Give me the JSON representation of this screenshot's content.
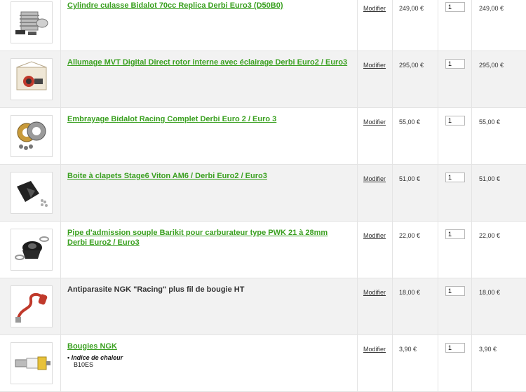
{
  "cart": {
    "items": [
      {
        "name": "Cylindre culasse Bidalot 70cc Replica Derbi Euro3 (D50B0)",
        "link": true,
        "icon": "cylinder-kit-icon",
        "modify_label": "Modifier",
        "unit_price": "249,00 €",
        "quantity": "1",
        "total": "249,00 €"
      },
      {
        "name": "Allumage MVT Digital Direct rotor interne avec éclairage Derbi Euro2 / Euro3",
        "link": true,
        "icon": "ignition-kit-icon",
        "modify_label": "Modifier",
        "unit_price": "295,00 €",
        "quantity": "1",
        "total": "295,00 €"
      },
      {
        "name": "Embrayage Bidalot Racing Complet Derbi Euro 2 / Euro 3",
        "link": true,
        "icon": "clutch-discs-icon",
        "modify_label": "Modifier",
        "unit_price": "55,00 €",
        "quantity": "1",
        "total": "55,00 €"
      },
      {
        "name": "Boite à clapets Stage6 Viton AM6 / Derbi Euro2 / Euro3",
        "link": true,
        "icon": "reed-valve-icon",
        "modify_label": "Modifier",
        "unit_price": "51,00 €",
        "quantity": "1",
        "total": "51,00 €"
      },
      {
        "name": "Pipe d'admission souple Barikit pour carburateur type PWK 21 à 28mm Derbi Euro2 / Euro3",
        "link": true,
        "icon": "intake-manifold-icon",
        "modify_label": "Modifier",
        "unit_price": "22,00 €",
        "quantity": "1",
        "total": "22,00 €"
      },
      {
        "name": "Antiparasite NGK \"Racing\" plus fil de bougie HT",
        "link": false,
        "icon": "spark-plug-cap-icon",
        "modify_label": "Modifier",
        "unit_price": "18,00 €",
        "quantity": "1",
        "total": "18,00 €"
      },
      {
        "name": "Bougies NGK",
        "link": true,
        "icon": "spark-plug-icon",
        "attribute_label": "Indice de chaleur",
        "attribute_value": "B10ES",
        "modify_label": "Modifier",
        "unit_price": "3,90 €",
        "quantity": "1",
        "total": "3,90 €"
      }
    ]
  },
  "colors": {
    "link_green": "#3aa020",
    "alt_row": "#f2f2f2",
    "border": "#e4e4e4"
  }
}
